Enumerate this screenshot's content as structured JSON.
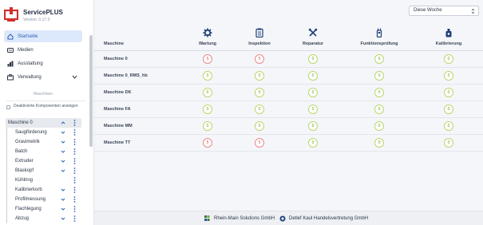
{
  "app": {
    "title": "ServicePLUS",
    "version": "Version: 0.17.0",
    "logo_icon": "service-plus-logo-icon",
    "accent_color": "#d32f2f"
  },
  "nav": {
    "items": [
      {
        "label": "Startseite",
        "icon": "home-icon",
        "active": true
      },
      {
        "label": "Medien",
        "icon": "media-icon"
      },
      {
        "label": "Ausstattung",
        "icon": "equipment-icon"
      },
      {
        "label": "Verwaltung",
        "icon": "admin-icon"
      }
    ]
  },
  "sidebar": {
    "section_label": "Maschinen",
    "deactivated_label": "Deaktivierte Komponenten anzeigen",
    "deactivated_checked": false,
    "tree": {
      "root": "Maschine 0",
      "children": [
        "Saugförderung",
        "Gravimetrik",
        "Batch",
        "Extruder",
        "Blaskopf",
        "Kühlring",
        "Kalibrierkorb",
        "Profilmessung",
        "Flachlegung",
        "Abzug"
      ]
    }
  },
  "filter": {
    "selected": "Diese Woche"
  },
  "table": {
    "machine_header": "Maschine",
    "columns": [
      {
        "label": "Wartung",
        "icon": "gear-icon"
      },
      {
        "label": "Inspektion",
        "icon": "clipboard-icon"
      },
      {
        "label": "Reparatur",
        "icon": "tools-icon"
      },
      {
        "label": "Funktionsprüfung",
        "icon": "test-device-icon"
      },
      {
        "label": "Kalibrierung",
        "icon": "calibration-icon"
      }
    ],
    "rows": [
      {
        "machine": "Maschine 0",
        "values": [
          "5",
          "5",
          "0",
          "0",
          "0"
        ],
        "status": [
          "warn",
          "warn",
          "ok",
          "ok",
          "ok"
        ]
      },
      {
        "machine": "Maschine 0_RMS_hb",
        "values": [
          "0",
          "0",
          "0",
          "0",
          "0"
        ],
        "status": [
          "ok",
          "ok",
          "ok",
          "ok",
          "ok"
        ]
      },
      {
        "machine": "Maschine DK",
        "values": [
          "0",
          "0",
          "0",
          "0",
          "0"
        ],
        "status": [
          "ok",
          "ok",
          "ok",
          "ok",
          "ok"
        ]
      },
      {
        "machine": "Maschine FA",
        "values": [
          "0",
          "0",
          "0",
          "0",
          "0"
        ],
        "status": [
          "ok",
          "ok",
          "ok",
          "ok",
          "ok"
        ]
      },
      {
        "machine": "Maschine MM",
        "values": [
          "0",
          "0",
          "0",
          "0",
          "0"
        ],
        "status": [
          "ok",
          "ok",
          "ok",
          "ok",
          "ok"
        ]
      },
      {
        "machine": "Maschine TT",
        "values": [
          "5",
          "5",
          "0",
          "0",
          "0"
        ],
        "status": [
          "warn",
          "warn",
          "ok",
          "ok",
          "ok"
        ]
      }
    ],
    "ok_color": "#b7d96a",
    "warn_color": "#e88a8a"
  },
  "footer": {
    "left": "Rhein-Main Solutions GmbH",
    "right": "Detlef Kaul Handelsvertretung GmbH",
    "left_icon": "rhein-main-logo-icon",
    "right_icon": "kaul-logo-icon"
  }
}
